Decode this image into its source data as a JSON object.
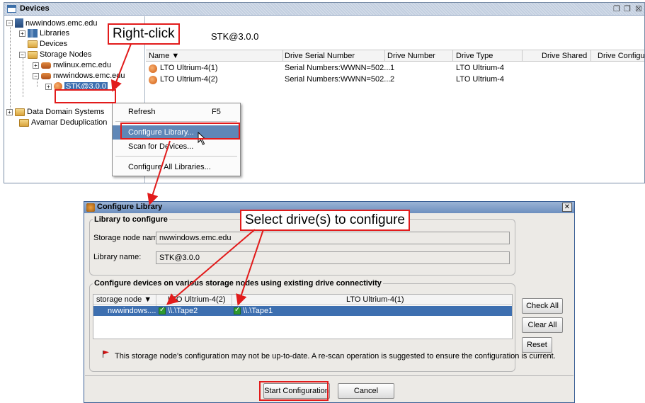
{
  "devices_window": {
    "title": "Devices",
    "title_buttons": [
      "❐",
      "❐",
      "☒"
    ],
    "path": "STK@3.0.0",
    "tree": [
      {
        "label": "nwwindows.emc.edu"
      },
      {
        "label": "Libraries"
      },
      {
        "label": "Devices"
      },
      {
        "label": "Storage Nodes"
      },
      {
        "label": "nwlinux.emc.edu"
      },
      {
        "label": "nwwindows.emc.edu"
      },
      {
        "label": "STK@3.0.0"
      },
      {
        "label": "Data Domain Systems"
      },
      {
        "label": "Avamar Deduplication"
      }
    ],
    "columns": [
      "Name ▼",
      "Drive Serial Number",
      "Drive Number",
      "Drive Type",
      "Drive Shared",
      "Drive Configured"
    ],
    "rows": [
      {
        "name": "LTO Ultrium-4(1)",
        "serial": "Serial Numbers:WWNN=502...",
        "number": "1",
        "type": "LTO Ultrium-4"
      },
      {
        "name": "LTO Ultrium-4(2)",
        "serial": "Serial Numbers:WWNN=502...",
        "number": "2",
        "type": "LTO Ultrium-4"
      }
    ]
  },
  "context_menu": {
    "refresh": "Refresh",
    "refresh_shortcut": "F5",
    "configure_library": "Configure Library...",
    "scan": "Scan for Devices...",
    "configure_all": "Configure All Libraries..."
  },
  "callouts": {
    "right_click": "Right-click",
    "select_drives": "Select drive(s) to configure"
  },
  "dialog": {
    "title": "Configure Library",
    "close": "✕",
    "group1": "Library to configure",
    "storage_node_label": "Storage node name:",
    "storage_node_value": "nwwindows.emc.edu",
    "library_label": "Library name:",
    "library_value": "STK@3.0.0",
    "group2": "Configure devices on various storage nodes using existing drive connectivity",
    "table_header": [
      "storage node ▼",
      "LTO Ultrium-4(2)",
      "LTO Ultrium-4(1)"
    ],
    "table_row": {
      "node": "nwwindows....",
      "drive2": "\\\\.\\Tape2",
      "drive1": "\\\\.\\Tape1"
    },
    "check_all": "Check All",
    "clear_all": "Clear All",
    "reset": "Reset",
    "notice": "This storage node's configuration may not be up-to-date.  A re-scan operation is suggested to ensure the configuration is current.",
    "start": "Start Configuration",
    "cancel": "Cancel"
  },
  "colors": {
    "annotation": "#e21b1b",
    "selection": "#3d6fb0"
  }
}
